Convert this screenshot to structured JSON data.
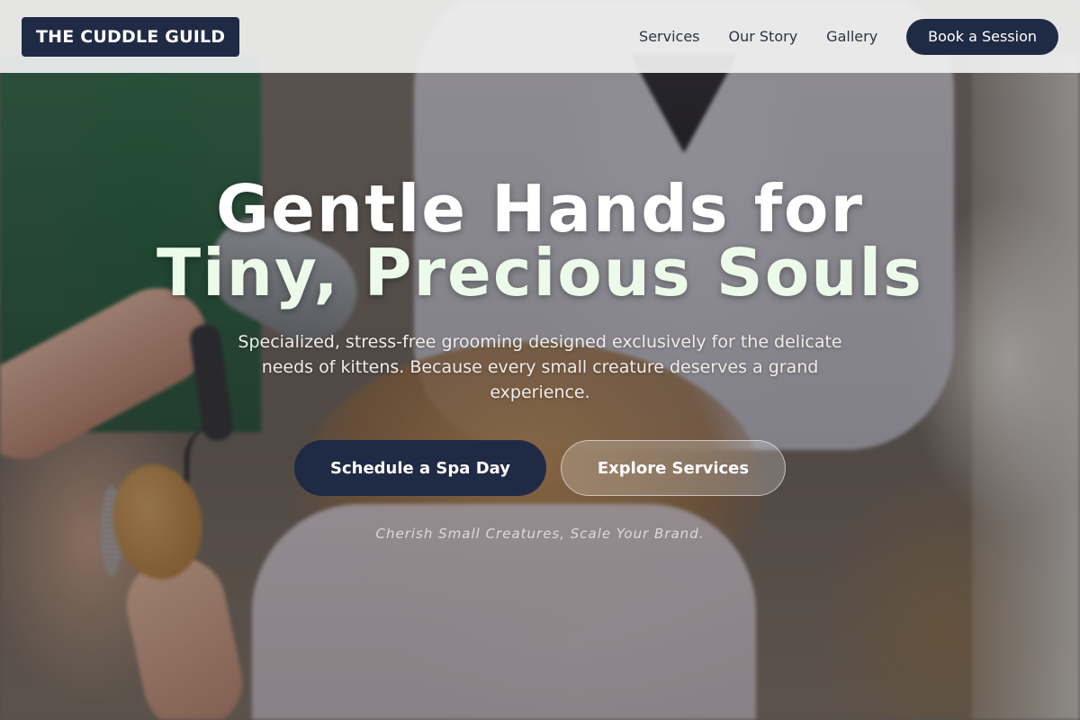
{
  "nav": {
    "logo": "THE CUDDLE GUILD",
    "links": [
      "Services",
      "Our Story",
      "Gallery"
    ],
    "cta": "Book a Session"
  },
  "hero": {
    "headline_line1": "Gentle Hands for",
    "headline_line2": "Tiny, Precious Souls",
    "subtitle": "Specialized, stress-free grooming designed exclusively for the delicate needs of kittens. Because every small creature deserves a grand experience.",
    "primary_button": "Schedule a Spa Day",
    "secondary_button": "Explore Services",
    "tagline": "Cherish Small Creatures, Scale Your Brand."
  },
  "colors": {
    "brand_navy": "#1f2a44",
    "headline_accent": "#ecfbe9"
  }
}
